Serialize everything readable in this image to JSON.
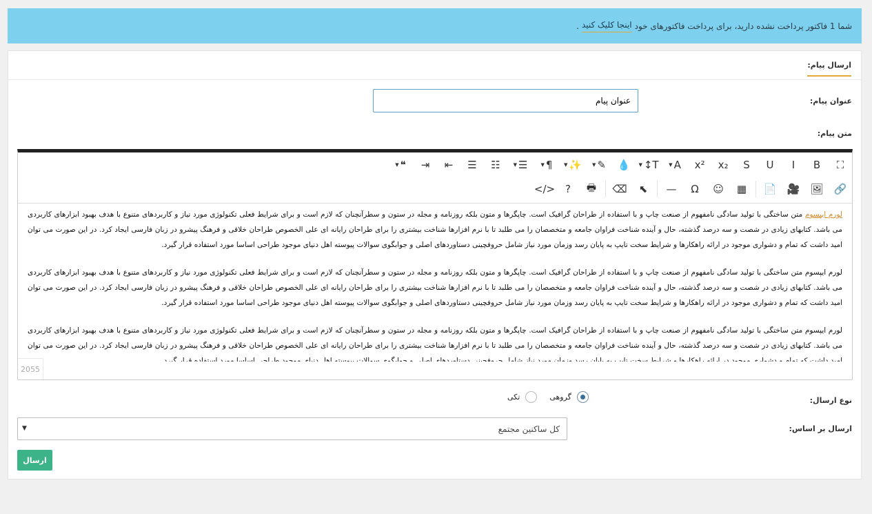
{
  "alert": {
    "text_before": "شما 1 فاکتور پرداخت نشده دارید، برای پرداخت فاکتورهای خود",
    "link": "اینجا کلیک کنید",
    "text_after": "."
  },
  "card": {
    "title": "ارسال پیام:"
  },
  "form": {
    "subject_label": "عنوان پیام:",
    "subject_value": "عنوان پیام",
    "body_label": "متن پیام:",
    "type_label": "نوع ارسال:",
    "type_options": [
      {
        "label": "گروهی",
        "selected": true
      },
      {
        "label": "تکی",
        "selected": false
      }
    ],
    "basis_label": "ارسال بر اساس:",
    "basis_value": "کل ساکنین مجتمع",
    "submit_label": "ارسال"
  },
  "editor": {
    "char_count": "2055",
    "toolbar_row1": [
      {
        "name": "fullscreen-icon",
        "glyph": "⛶"
      },
      {
        "name": "bold-icon",
        "glyph": "B"
      },
      {
        "name": "italic-icon",
        "glyph": "I"
      },
      {
        "name": "underline-icon",
        "glyph": "U"
      },
      {
        "name": "strikethrough-icon",
        "glyph": "S"
      },
      {
        "name": "subscript-icon",
        "glyph": "x₂"
      },
      {
        "name": "superscript-icon",
        "glyph": "x²"
      },
      {
        "name": "font-family-icon",
        "glyph": "A",
        "dropdown": true
      },
      {
        "name": "font-size-icon",
        "glyph": "T↕",
        "dropdown": true
      },
      {
        "name": "color-icon",
        "glyph": "💧"
      },
      {
        "name": "paint-format-icon",
        "glyph": "✎",
        "dropdown": true
      },
      {
        "name": "magic-wand-icon",
        "glyph": "✨",
        "dropdown": true
      },
      {
        "name": "paragraph-icon",
        "glyph": "¶",
        "dropdown": true
      },
      {
        "name": "align-icon",
        "glyph": "☰",
        "dropdown": true
      },
      {
        "name": "ordered-list-icon",
        "glyph": "☷"
      },
      {
        "name": "unordered-list-icon",
        "glyph": "☰"
      },
      {
        "name": "outdent-icon",
        "glyph": "⇤"
      },
      {
        "name": "indent-icon",
        "glyph": "⇥"
      },
      {
        "name": "quote-icon",
        "glyph": "❝",
        "dropdown": true
      }
    ],
    "toolbar_row2": [
      {
        "name": "link-icon",
        "glyph": "🔗"
      },
      {
        "name": "image-icon",
        "glyph": "🖼"
      },
      {
        "name": "video-icon",
        "glyph": "🎥"
      },
      {
        "name": "file-icon",
        "glyph": "📄"
      },
      {
        "name": "table-icon",
        "glyph": "▦"
      },
      {
        "name": "emoji-icon",
        "glyph": "☺"
      },
      {
        "name": "special-char-icon",
        "glyph": "Ω"
      },
      {
        "name": "horizontal-line-icon",
        "glyph": "—"
      },
      {
        "name": "select-all-icon",
        "glyph": "⬉"
      },
      {
        "name": "clear-format-icon",
        "glyph": "⌫"
      },
      {
        "name": "print-icon",
        "glyph": "🖶"
      },
      {
        "name": "help-icon",
        "glyph": "?"
      },
      {
        "name": "code-view-icon",
        "glyph": "</>"
      }
    ],
    "highlight_word": "لورم ایپسوم",
    "paragraph_first_rest": " متن ساختگی با تولید سادگی نامفهوم از صنعت چاپ و با استفاده از طراحان گرافیک است. چاپگرها و متون بلکه روزنامه و مجله در ستون و سطرآنچنان که لازم است و برای شرایط فعلی تکنولوژی مورد نیاز و کاربردهای متنوع با هدف بهبود ابزارهای کاربردی می باشد. کتابهای زیادی در شصت و سه درصد گذشته، حال و آینده شناخت فراوان جامعه و متخصصان را می طلبد تا با نرم افزارها شناخت بیشتری را برای طراحان رایانه ای علی الخصوص طراحان خلاقی و فرهنگ پیشرو در زبان فارسی ایجاد کرد. در این صورت می توان امید داشت که تمام و دشواری موجود در ارائه راهکارها و شرایط سخت تایپ به پایان رسد وزمان مورد نیاز شامل حروفچینی دستاوردهای اصلی و جوابگوی سوالات پیوسته اهل دنیای موجود طراحی اساسا مورد استفاده قرار گیرد.",
    "paragraph": "لورم ایپسوم متن ساختگی با تولید سادگی نامفهوم از صنعت چاپ و با استفاده از طراحان گرافیک است. چاپگرها و متون بلکه روزنامه و مجله در ستون و سطرآنچنان که لازم است و برای شرایط فعلی تکنولوژی مورد نیاز و کاربردهای متنوع با هدف بهبود ابزارهای کاربردی می باشد. کتابهای زیادی در شصت و سه درصد گذشته، حال و آینده شناخت فراوان جامعه و متخصصان را می طلبد تا با نرم افزارها شناخت بیشتری را برای طراحان رایانه ای علی الخصوص طراحان خلاقی و فرهنگ پیشرو در زبان فارسی ایجاد کرد. در این صورت می توان امید داشت که تمام و دشواری موجود در ارائه راهکارها و شرایط سخت تایپ به پایان رسد وزمان مورد نیاز شامل حروفچینی دستاوردهای اصلی و جوابگوی سوالات پیوسته اهل دنیای موجود طراحی اساسا مورد استفاده قرار گیرد."
  }
}
